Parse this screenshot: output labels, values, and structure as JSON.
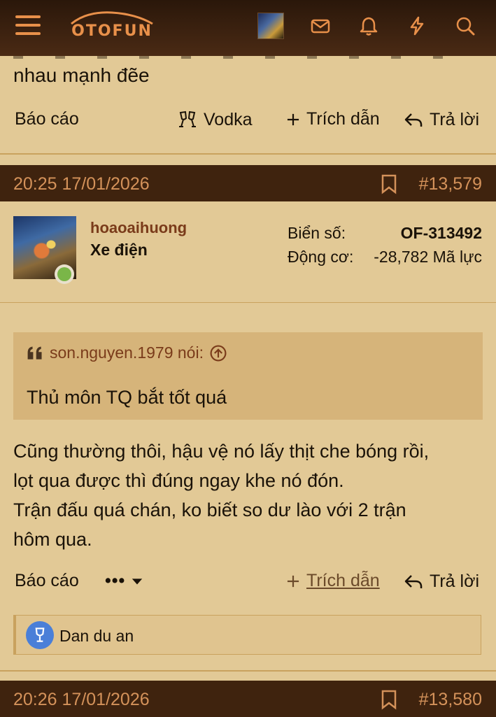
{
  "header": {
    "logo_text": "OTOFUN",
    "icons": [
      "menu-icon",
      "avatar",
      "mail-icon",
      "bell-icon",
      "bolt-icon",
      "search-icon"
    ],
    "accent": "#e8904a"
  },
  "prev_post": {
    "tail_text": "nhau mạnh đẽe",
    "actions": {
      "report": "Báo cáo",
      "react": "Vodka",
      "quote": "Trích dẫn",
      "reply": "Trả lời"
    }
  },
  "post": {
    "date": "20:25 17/01/2026",
    "number": "#13,579",
    "username": "hoaoaihuong",
    "user_title": "Xe điện",
    "plate_label": "Biển số:",
    "plate_value": "OF-313492",
    "engine_label": "Động cơ:",
    "engine_value": "-28,782 Mã lực",
    "quote_author": "son.nguyen.1979 nói:",
    "quote_text": "Thủ môn TQ bắt tốt quá",
    "body_lines": [
      "Cũng thường thôi, hậu vệ nó lấy thịt che bóng rồi,",
      "lọt qua được thì đúng ngay khe nó đón.",
      "Trận đấu quá chán, ko biết so dư lào với 2 trận",
      "hôm qua."
    ],
    "actions": {
      "report": "Báo cáo",
      "more": "•••",
      "quote": "Trích dẫn",
      "reply": "Trả lời"
    },
    "reaction_by": "Dan du an"
  },
  "next_post": {
    "date": "20:26 17/01/2026",
    "number": "#13,580"
  }
}
